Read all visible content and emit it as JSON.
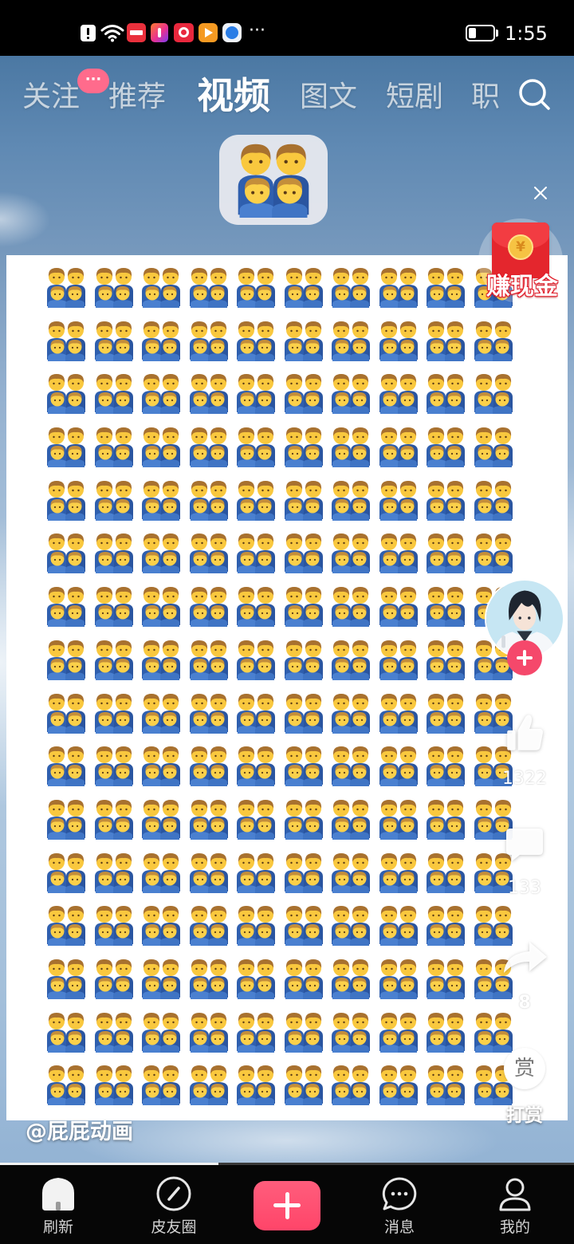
{
  "status_bar": {
    "time": "1:55",
    "more": "···",
    "battery_level": 0.3,
    "icons": [
      "notification-alert-icon",
      "wifi-icon",
      "xiaohongshu-app-icon",
      "multicolor-app-icon",
      "red-app-icon",
      "orange-play-app-icon",
      "blue-app-icon",
      "battery-icon"
    ]
  },
  "top_nav": {
    "tabs": [
      {
        "label": "关注",
        "badge": "···"
      },
      {
        "label": "推荐"
      },
      {
        "label": "视频",
        "active": true
      },
      {
        "label": "图文"
      },
      {
        "label": "短剧"
      },
      {
        "label": "职"
      }
    ],
    "search_icon": "search-icon"
  },
  "video": {
    "header_icon": "family-emoji-icon",
    "emoji_grid": {
      "icon": "family-emoji-icon",
      "rows": 16,
      "columns": 10
    },
    "author": "@屁屁动画",
    "progress": 0.38
  },
  "promo": {
    "icon": "red-envelope-icon",
    "coin_symbol": "¥",
    "label": "赚现金",
    "close_icon": "close-icon"
  },
  "actions": {
    "avatar_icon": "author-avatar-icon",
    "follow_icon": "plus-icon",
    "like": {
      "icon": "thumbs-up-icon",
      "count": "1322"
    },
    "comment": {
      "icon": "comment-icon",
      "count": "133"
    },
    "share": {
      "icon": "share-icon",
      "count": "8"
    },
    "reward": {
      "symbol": "赏",
      "label": "打赏"
    }
  },
  "bottom_nav": {
    "items": [
      {
        "icon": "home-icon",
        "label": "刷新",
        "active": true
      },
      {
        "icon": "compass-icon",
        "label": "皮友圈"
      },
      {
        "icon": "chat-icon",
        "label": "消息"
      },
      {
        "icon": "person-icon",
        "label": "我的"
      }
    ],
    "publish": {
      "icon": "plus-icon"
    }
  },
  "colors": {
    "accent": "#f5486b",
    "envelope": "#e4262d",
    "coin": "#f6c343",
    "tab_active": "#ffffff",
    "tab_inactive": "#c8d4df",
    "nav_label": "#d4d4d4"
  }
}
